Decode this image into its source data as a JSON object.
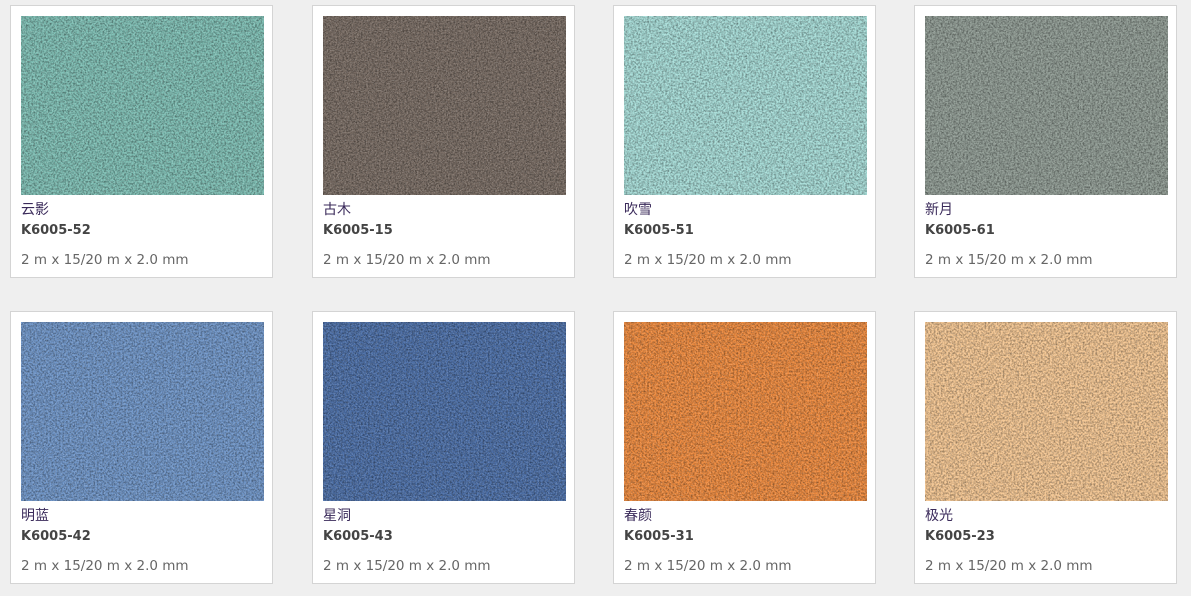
{
  "products": [
    {
      "name": "云影",
      "code": "K6005-52",
      "size": "2 m x 15/20 m x 2.0 mm",
      "color": "#7dbfb4",
      "speck_dark": "#5f9e94",
      "speck_light": "#a8dcd2"
    },
    {
      "name": "古木",
      "code": "K6005-15",
      "size": "2 m x 15/20 m x 2.0 mm",
      "color": "#776a61",
      "speck_dark": "#5a4f48",
      "speck_light": "#9a8c80"
    },
    {
      "name": "吹雪",
      "code": "K6005-51",
      "size": "2 m x 15/20 m x 2.0 mm",
      "color": "#a6ddd8",
      "speck_dark": "#82c2bd",
      "speck_light": "#cdf0ec"
    },
    {
      "name": "新月",
      "code": "K6005-61",
      "size": "2 m x 15/20 m x 2.0 mm",
      "color": "#8e9a92",
      "speck_dark": "#5f6b7a",
      "speck_light": "#b7bda7"
    },
    {
      "name": "明蓝",
      "code": "K6005-42",
      "size": "2 m x 15/20 m x 2.0 mm",
      "color": "#6e95c9",
      "speck_dark": "#4f75aa",
      "speck_light": "#9bbbe4"
    },
    {
      "name": "星洞",
      "code": "K6005-43",
      "size": "2 m x 15/20 m x 2.0 mm",
      "color": "#4a6ea8",
      "speck_dark": "#2e4e86",
      "speck_light": "#7896c8"
    },
    {
      "name": "春颜",
      "code": "K6005-31",
      "size": "2 m x 15/20 m x 2.0 mm",
      "color": "#f08a3c",
      "speck_dark": "#d26a1e",
      "speck_light": "#f8ad6c"
    },
    {
      "name": "极光",
      "code": "K6005-23",
      "size": "2 m x 15/20 m x 2.0 mm",
      "color": "#f6c792",
      "speck_dark": "#dcaa72",
      "speck_light": "#fbdcb4"
    }
  ]
}
